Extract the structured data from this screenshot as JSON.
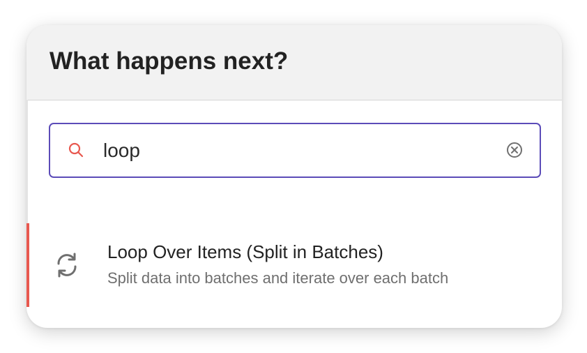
{
  "panel": {
    "title": "What happens next?"
  },
  "search": {
    "value": "loop",
    "icon": "search-icon",
    "clear_icon": "clear-circle-icon"
  },
  "results": [
    {
      "title": "Loop Over Items (Split in Batches)",
      "description": "Split data into batches and iterate over each batch",
      "icon": "refresh-loop-icon"
    }
  ],
  "colors": {
    "accent": "#e8584f",
    "focus_border": "#5b4bb8",
    "header_bg": "#f2f2f2"
  }
}
